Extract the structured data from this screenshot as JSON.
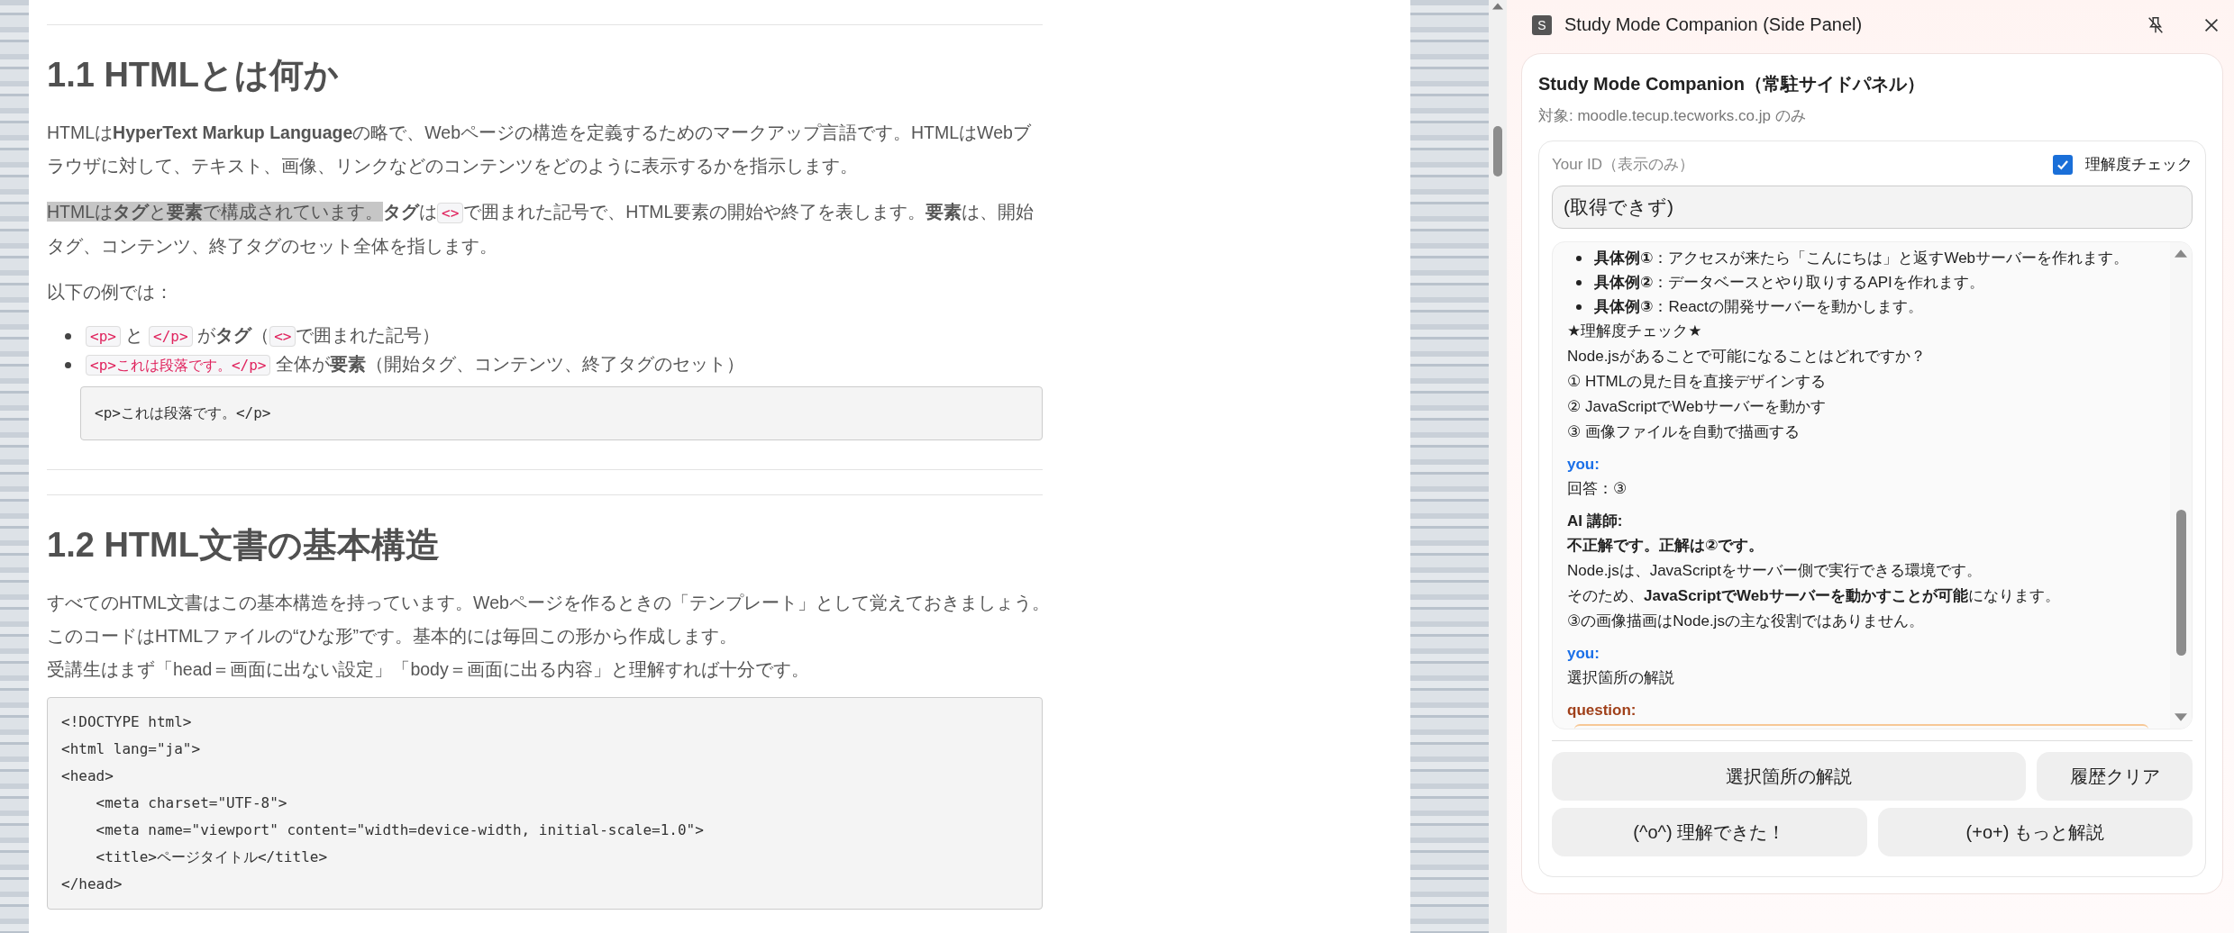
{
  "article": {
    "sections": [
      {
        "heading": "1.1 HTMLとは何か",
        "blocks": [
          {
            "kind": "paragraph",
            "segments": [
              {
                "kind": "text",
                "text": "HTMLは**HyperText Markup Language**の略で、Webページの構造を定義するためのマークアップ言語です。HTMLはWebブラウザに対して、テキスト、画像、リンクなどのコンテンツをどのように表示するかを指示します。",
                "selected": false
              }
            ]
          },
          {
            "kind": "paragraph",
            "segments": [
              {
                "kind": "text",
                "text": "HTMLは**タグ**と**要素**で構成されています。",
                "selected": true
              },
              {
                "kind": "text",
                "text": "**タグ**は",
                "selected": false
              },
              {
                "kind": "code",
                "text": "<>"
              },
              {
                "kind": "text",
                "text": "で囲まれた記号で、HTML要素の開始や終了を表します。**要素**は、開始タグ、コンテンツ、終了タグのセット全体を指します。",
                "selected": false
              }
            ]
          },
          {
            "kind": "paragraph",
            "segments": [
              {
                "kind": "text",
                "text": "以下の例では：",
                "selected": false
              }
            ]
          },
          {
            "kind": "list",
            "items": [
              [
                {
                  "kind": "code",
                  "text": "<p>"
                },
                {
                  "kind": "text",
                  "text": " と ",
                  "selected": false
                },
                {
                  "kind": "code",
                  "text": "</p>"
                },
                {
                  "kind": "text",
                  "text": " が**タグ**（",
                  "selected": false
                },
                {
                  "kind": "code",
                  "text": "<>"
                },
                {
                  "kind": "text",
                  "text": "で囲まれた記号）",
                  "selected": false
                }
              ],
              [
                {
                  "kind": "code",
                  "text": "<p>これは段落です。</p>"
                },
                {
                  "kind": "text",
                  "text": " 全体が**要素**（開始タグ、コンテンツ、終了タグのセット）",
                  "selected": false
                }
              ]
            ]
          },
          {
            "kind": "code",
            "indented": true,
            "lines": [
              "<p>これは段落です。</p>"
            ]
          },
          {
            "kind": "rule"
          }
        ]
      },
      {
        "heading": "1.2 HTML文書の基本構造",
        "blocks": [
          {
            "kind": "lines",
            "lines": [
              "すべてのHTML文書はこの基本構造を持っています。Webページを作るときの「テンプレート」として覚えておきましょう。",
              "このコードはHTMLファイルの“ひな形”です。基本的には毎回この形から作成します。",
              "受講生はまず「head＝画面に出ない設定」「body＝画面に出る内容」と理解すれば十分です。"
            ]
          },
          {
            "kind": "code",
            "indented": false,
            "lines": [
              "<!DOCTYPE html>",
              "<html lang=\"ja\">",
              "<head>",
              "    <meta charset=\"UTF-8\">",
              "    <meta name=\"viewport\" content=\"width=device-width, initial-scale=1.0\">",
              "    <title>ページタイトル</title>",
              "</head>"
            ]
          }
        ]
      }
    ]
  },
  "side_panel": {
    "header": {
      "badge": "S",
      "title": "Study Mode Companion (Side Panel)"
    },
    "title": "Study Mode Companion（常駐サイドパネル）",
    "subtitle": "対象: moodle.tecup.tecworks.co.jp のみ",
    "id_label": "Your ID（表示のみ）",
    "check": {
      "label": "理解度チェック",
      "checked": true
    },
    "id_value": "(取得できず)",
    "messages": [
      {
        "kind": "ai",
        "bullets": [
          "**具体例①**：アクセスが来たら「こんにちは」と返すWebサーバーを作れます。",
          "**具体例②**：データベースとやり取りするAPIを作れます。",
          "**具体例③**：Reactの開発サーバーを動かします。"
        ],
        "lines": [
          "★理解度チェック★",
          "Node.jsがあることで可能になることはどれですか？",
          "① HTMLの見た目を直接デザインする",
          "② JavaScriptでWebサーバーを動かす",
          "③ 画像ファイルを自動で描画する"
        ]
      },
      {
        "kind": "you",
        "speaker": "you:",
        "lines": [
          "回答：③"
        ]
      },
      {
        "kind": "ai",
        "speaker": "AI 講師:",
        "lines": [
          "**不正解です。正解は②です。**",
          "Node.jsは、JavaScriptをサーバー側で実行できる環境です。",
          "そのため、**JavaScriptでWebサーバーを動かすことが可能**になります。",
          "③の画像描画はNode.jsの主な役割ではありません。"
        ]
      },
      {
        "kind": "you",
        "speaker": "you:",
        "lines": [
          "選択箇所の解説"
        ]
      },
      {
        "kind": "question",
        "speaker": "question:"
      }
    ],
    "buttons": [
      [
        "選択箇所の解説",
        "履歴クリア"
      ],
      [
        "(^o^) 理解できた！",
        "(+o+) もっと解説"
      ]
    ]
  }
}
